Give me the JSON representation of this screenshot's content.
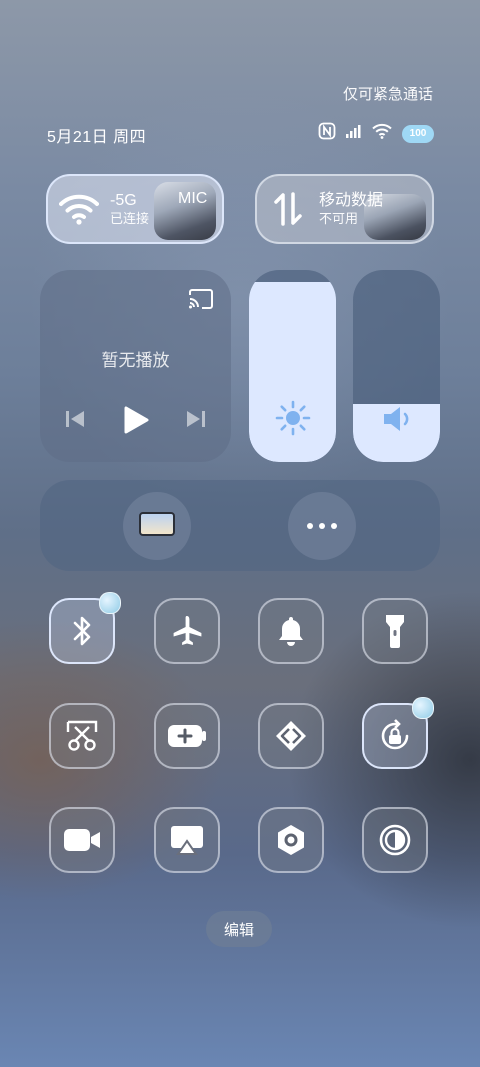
{
  "status": {
    "emergency_text": "仅可紧急通话",
    "date_text": "5月21日 周四",
    "battery_level": "100"
  },
  "wifi_card": {
    "network": "-5G",
    "status": "已连接",
    "overlay_text": "MIC"
  },
  "data_card": {
    "title": "移动数据",
    "status": "不可用"
  },
  "media": {
    "no_playback": "暂无播放"
  },
  "sliders": {
    "brightness_level": 0.94,
    "volume_level": 0.3
  },
  "tiles": [
    {
      "name": "bluetooth",
      "icon": "bluetooth-icon",
      "active": true
    },
    {
      "name": "airplane-mode",
      "icon": "airplane-icon",
      "active": false
    },
    {
      "name": "silent-mode",
      "icon": "bell-icon",
      "active": false
    },
    {
      "name": "flashlight",
      "icon": "flashlight-icon",
      "active": false
    },
    {
      "name": "screenshot",
      "icon": "scissors-icon",
      "active": false
    },
    {
      "name": "battery-saver",
      "icon": "battery-plus-icon",
      "active": false
    },
    {
      "name": "link-share",
      "icon": "link-icon",
      "active": false
    },
    {
      "name": "rotation-lock",
      "icon": "rotation-lock-icon",
      "active": true
    },
    {
      "name": "screen-record",
      "icon": "video-camera-icon",
      "active": false
    },
    {
      "name": "screen-cast",
      "icon": "airplay-icon",
      "active": false
    },
    {
      "name": "settings-hex",
      "icon": "hexagon-nut-icon",
      "active": false
    },
    {
      "name": "dark-mode",
      "icon": "contrast-icon",
      "active": false
    }
  ],
  "edit_label": "编辑",
  "colors": {
    "accent": "#dde8ff",
    "battery": "#9fd8f5"
  }
}
